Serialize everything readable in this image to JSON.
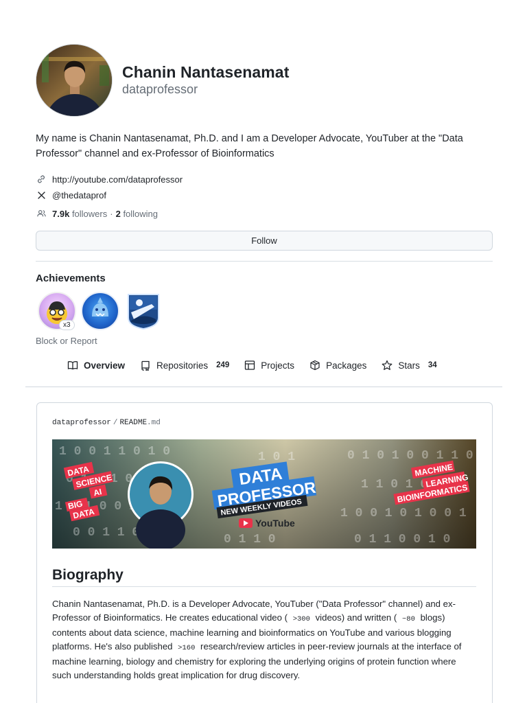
{
  "profile": {
    "name": "Chanin Nantasenamat",
    "login": "dataprofessor",
    "bio": "My name is Chanin Nantasenamat, Ph.D. and I am a Developer Advocate, YouTuber at the \"Data Professor\" channel and ex-Professor of Bioinformatics",
    "website": "http://youtube.com/dataprofessor",
    "twitter": "@thedataprof",
    "followers_count": "7.9k",
    "followers_label": "followers",
    "following_count": "2",
    "following_label": "following",
    "follow_button": "Follow"
  },
  "achievements": {
    "title": "Achievements",
    "badges": [
      {
        "name": "starstruck",
        "multiplier": "x3"
      },
      {
        "name": "shark"
      },
      {
        "name": "arctic-code-vault"
      }
    ],
    "block_report": "Block or Report"
  },
  "tabs": [
    {
      "label": "Overview",
      "icon": "book-icon",
      "active": true
    },
    {
      "label": "Repositories",
      "icon": "repo-icon",
      "count": "249"
    },
    {
      "label": "Projects",
      "icon": "table-icon"
    },
    {
      "label": "Packages",
      "icon": "package-icon"
    },
    {
      "label": "Stars",
      "icon": "star-icon",
      "count": "34"
    }
  ],
  "readme": {
    "owner": "dataprofessor",
    "sep": "/",
    "file_base": "README",
    "file_ext": ".md",
    "banner": {
      "left_tags": [
        "DATA",
        "SCIENCE",
        "AI",
        "BIG",
        "DATA"
      ],
      "title_line1": "DATA",
      "title_line2": "PROFESSOR",
      "subtitle": "NEW WEEKLY VIDEOS",
      "youtube": "YouTube",
      "right_tags": [
        "MACHINE",
        "LEARNING",
        "BIOINFORMATICS"
      ]
    },
    "heading": "Biography",
    "para_1": "Chanin Nantasenamat, Ph.D. is a Developer Advocate, YouTuber (\"Data Professor\" channel) and ex-Professor of Bioinformatics. He creates educational video ( ",
    "code_1": ">300",
    "para_2": " videos) and written ( ",
    "code_2": "~80",
    "para_3": " blogs) contents about data science, machine learning and bioinformatics on YouTube and various blogging platforms. He's also published ",
    "code_3": ">160",
    "para_4": " research/review articles in peer-review journals at the interface of machine learning, biology and chemistry for exploring the underlying origins of protein function where such understanding holds great implication for drug discovery."
  },
  "colors": {
    "text": "#1f2328",
    "muted": "#656d76",
    "border": "#d0d7de",
    "banner_red": "#e8334a",
    "banner_blue": "#2f7fd8"
  }
}
